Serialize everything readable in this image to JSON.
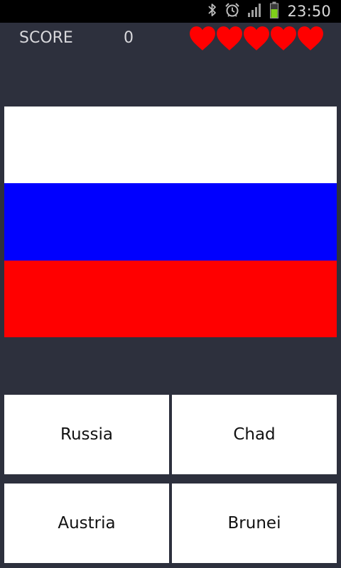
{
  "status_bar": {
    "time": "23:50",
    "icons": [
      "bluetooth-icon",
      "alarm-icon",
      "signal-icon",
      "battery-icon"
    ]
  },
  "game": {
    "score_label": "SCORE",
    "score_value": "0",
    "lives": 5,
    "heart_color": "#ff0000",
    "background_color": "#2d303d"
  },
  "flag": {
    "stripes": [
      "#ffffff",
      "#0000ff",
      "#ff0000"
    ]
  },
  "answers": [
    "Russia",
    "Chad",
    "Austria",
    "Brunei"
  ]
}
